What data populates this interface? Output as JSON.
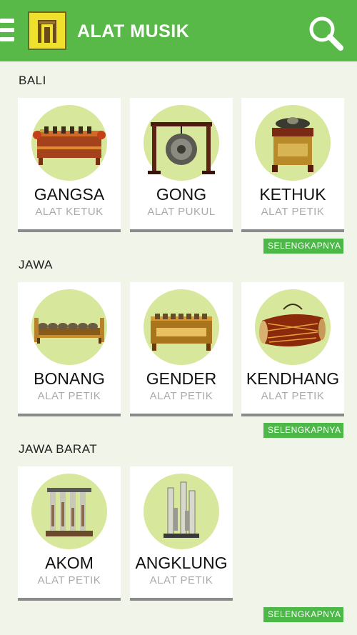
{
  "app": {
    "title": "ALAT MUSIK"
  },
  "sections": [
    {
      "label": "BALI",
      "items": [
        {
          "name": "GANGSA",
          "type": "ALAT KETUK",
          "icon": "gangsa-icon"
        },
        {
          "name": "GONG",
          "type": "ALAT PUKUL",
          "icon": "gong-icon"
        },
        {
          "name": "KETHUK",
          "type": "ALAT PETIK",
          "icon": "kethuk-icon"
        }
      ],
      "more_label": "SELENGKAPNYA"
    },
    {
      "label": "JAWA",
      "items": [
        {
          "name": "BONANG",
          "type": "ALAT PETIK",
          "icon": "bonang-icon"
        },
        {
          "name": "GENDER",
          "type": "ALAT PETIK",
          "icon": "gender-icon"
        },
        {
          "name": "KENDHANG",
          "type": "ALAT PETIK",
          "icon": "kendhang-icon"
        }
      ],
      "more_label": "SELENGKAPNYA"
    },
    {
      "label": "JAWA BARAT",
      "items": [
        {
          "name": "AKOM",
          "type": "ALAT PETIK",
          "icon": "akom-icon"
        },
        {
          "name": "ANGKLUNG",
          "type": "ALAT PETIK",
          "icon": "angklung-icon"
        }
      ],
      "more_label": "SELENGKAPNYA"
    }
  ],
  "colors": {
    "appbar": "#58b949",
    "button": "#4cb848",
    "circle": "#d7e79b",
    "background": "#f1f4e8"
  }
}
